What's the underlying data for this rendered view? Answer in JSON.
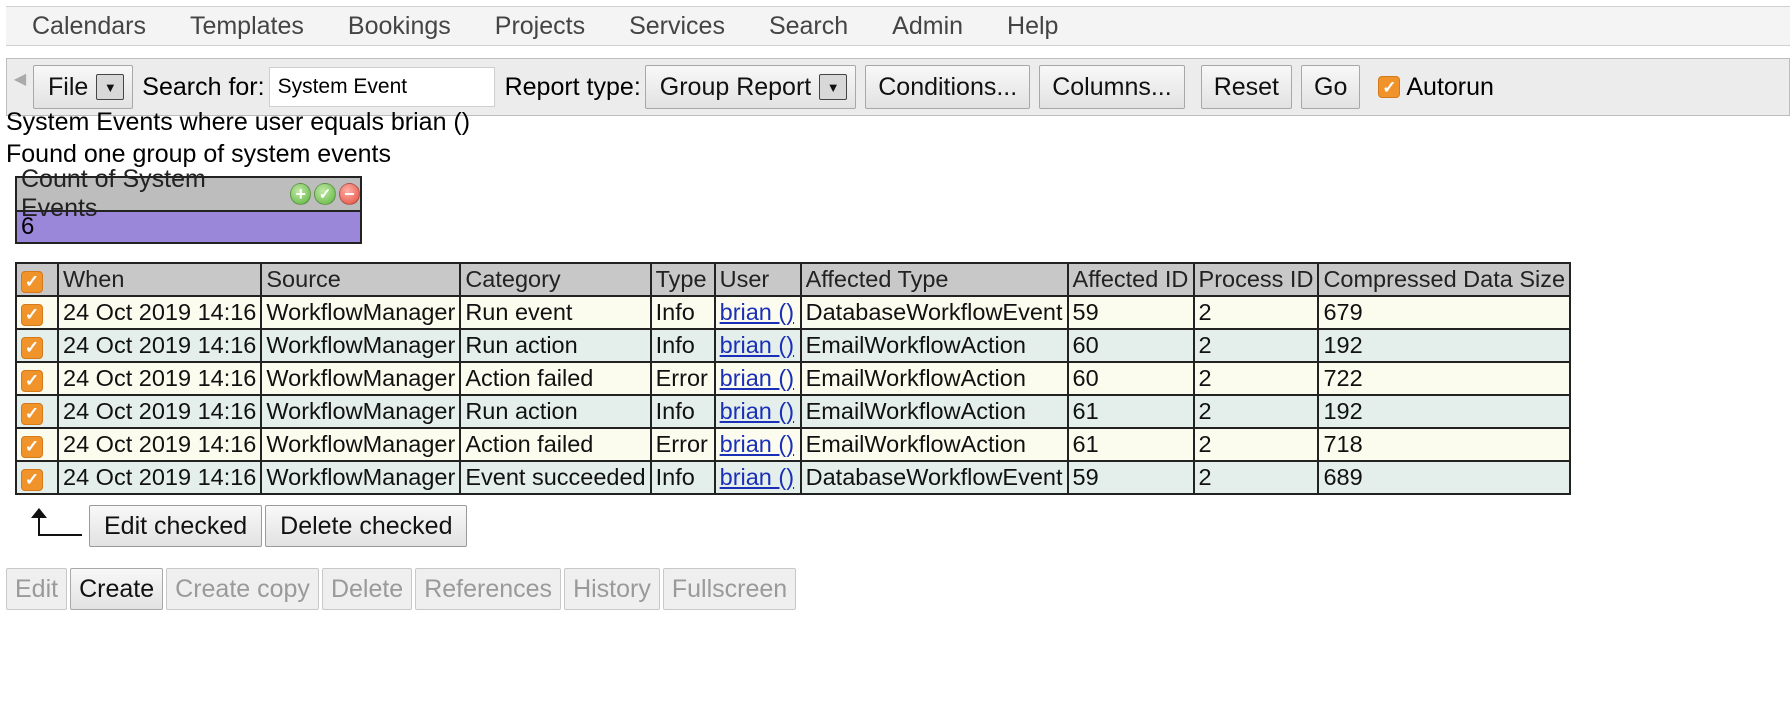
{
  "menu": [
    "Calendars",
    "Templates",
    "Bookings",
    "Projects",
    "Services",
    "Search",
    "Admin",
    "Help"
  ],
  "toolbar": {
    "file_label": "File",
    "search_label": "Search for:",
    "search_value": "System Event",
    "report_type_label": "Report type:",
    "report_type_value": "Group Report",
    "conditions": "Conditions...",
    "columns": "Columns...",
    "reset": "Reset",
    "go": "Go",
    "autorun_label": "Autorun",
    "autorun_checked": true
  },
  "summary": {
    "criteria": "System Events where user equals brian ()",
    "found": "Found one group of system events"
  },
  "group": {
    "header": "Count of System Events",
    "value": "6"
  },
  "table": {
    "headers": [
      "When",
      "Source",
      "Category",
      "Type",
      "User",
      "Affected Type",
      "Affected ID",
      "Process ID",
      "Compressed Data Size"
    ],
    "rows": [
      [
        "24 Oct 2019 14:16",
        "WorkflowManager",
        "Run event",
        "Info",
        "brian ()",
        "DatabaseWorkflowEvent",
        "59",
        "2",
        "679"
      ],
      [
        "24 Oct 2019 14:16",
        "WorkflowManager",
        "Run action",
        "Info",
        "brian ()",
        "EmailWorkflowAction",
        "60",
        "2",
        "192"
      ],
      [
        "24 Oct 2019 14:16",
        "WorkflowManager",
        "Action failed",
        "Error",
        "brian ()",
        "EmailWorkflowAction",
        "60",
        "2",
        "722"
      ],
      [
        "24 Oct 2019 14:16",
        "WorkflowManager",
        "Run action",
        "Info",
        "brian ()",
        "EmailWorkflowAction",
        "61",
        "2",
        "192"
      ],
      [
        "24 Oct 2019 14:16",
        "WorkflowManager",
        "Action failed",
        "Error",
        "brian ()",
        "EmailWorkflowAction",
        "61",
        "2",
        "718"
      ],
      [
        "24 Oct 2019 14:16",
        "WorkflowManager",
        "Event succeeded",
        "Info",
        "brian ()",
        "DatabaseWorkflowEvent",
        "59",
        "2",
        "689"
      ]
    ]
  },
  "checked_actions": {
    "edit": "Edit checked",
    "delete": "Delete checked"
  },
  "actions": {
    "edit": "Edit",
    "create": "Create",
    "create_copy": "Create copy",
    "delete": "Delete",
    "references": "References",
    "history": "History",
    "fullscreen": "Fullscreen"
  },
  "colors": {
    "checkbox": "#f0932b",
    "count_value_bg": "#9b87d9",
    "row_odd": "#fcfcee",
    "row_even": "#e4efeb",
    "link": "#1a2fb8"
  },
  "icons": {
    "checkbox": "✓",
    "add": "+",
    "ok": "✓",
    "remove": "−",
    "dropdown": "▼",
    "collapse": "◀"
  }
}
